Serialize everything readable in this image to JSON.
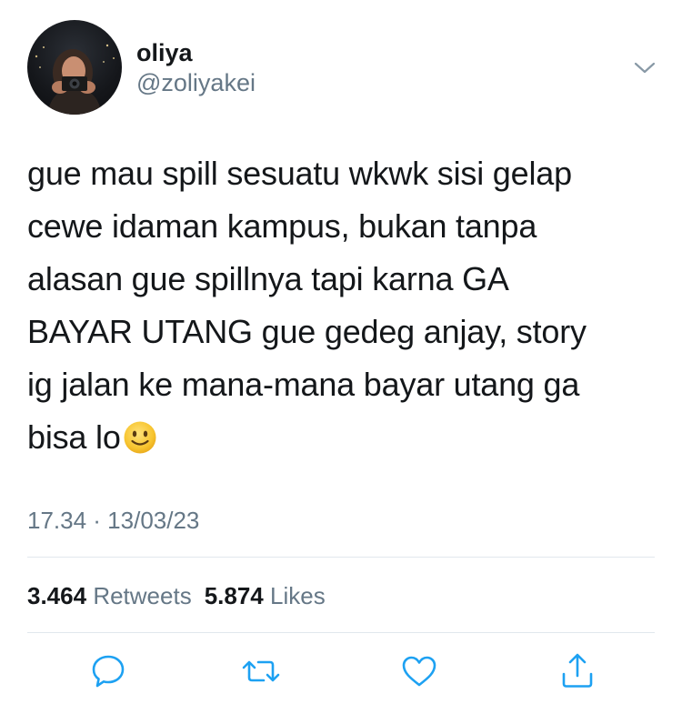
{
  "user": {
    "display_name": "oliya",
    "handle": "@zoliyakei",
    "avatar": "user-photo"
  },
  "tweet": {
    "lines": [
      "gue mau spill sesuatu wkwk sisi gelap",
      "cewe idaman kampus, bukan tanpa",
      "alasan gue spillnya tapi karna GA",
      "BAYAR UTANG gue gedeg anjay, story",
      "ig jalan ke mana-mana bayar utang ga",
      "bisa lo"
    ],
    "emoji": "slightly-smiling-face",
    "timestamp": "17.34 · 13/03/23"
  },
  "stats": {
    "retweets_count": "3.464",
    "retweets_label": "Retweets",
    "likes_count": "5.874",
    "likes_label": "Likes"
  },
  "icons": {
    "menu": "chevron-down-icon",
    "reply": "reply-icon",
    "retweet": "retweet-icon",
    "like": "heart-icon",
    "share": "share-icon"
  },
  "colors": {
    "text": "#14171a",
    "secondary": "#657786",
    "icon": "#1da1f2",
    "divider": "#e1e8ed"
  }
}
